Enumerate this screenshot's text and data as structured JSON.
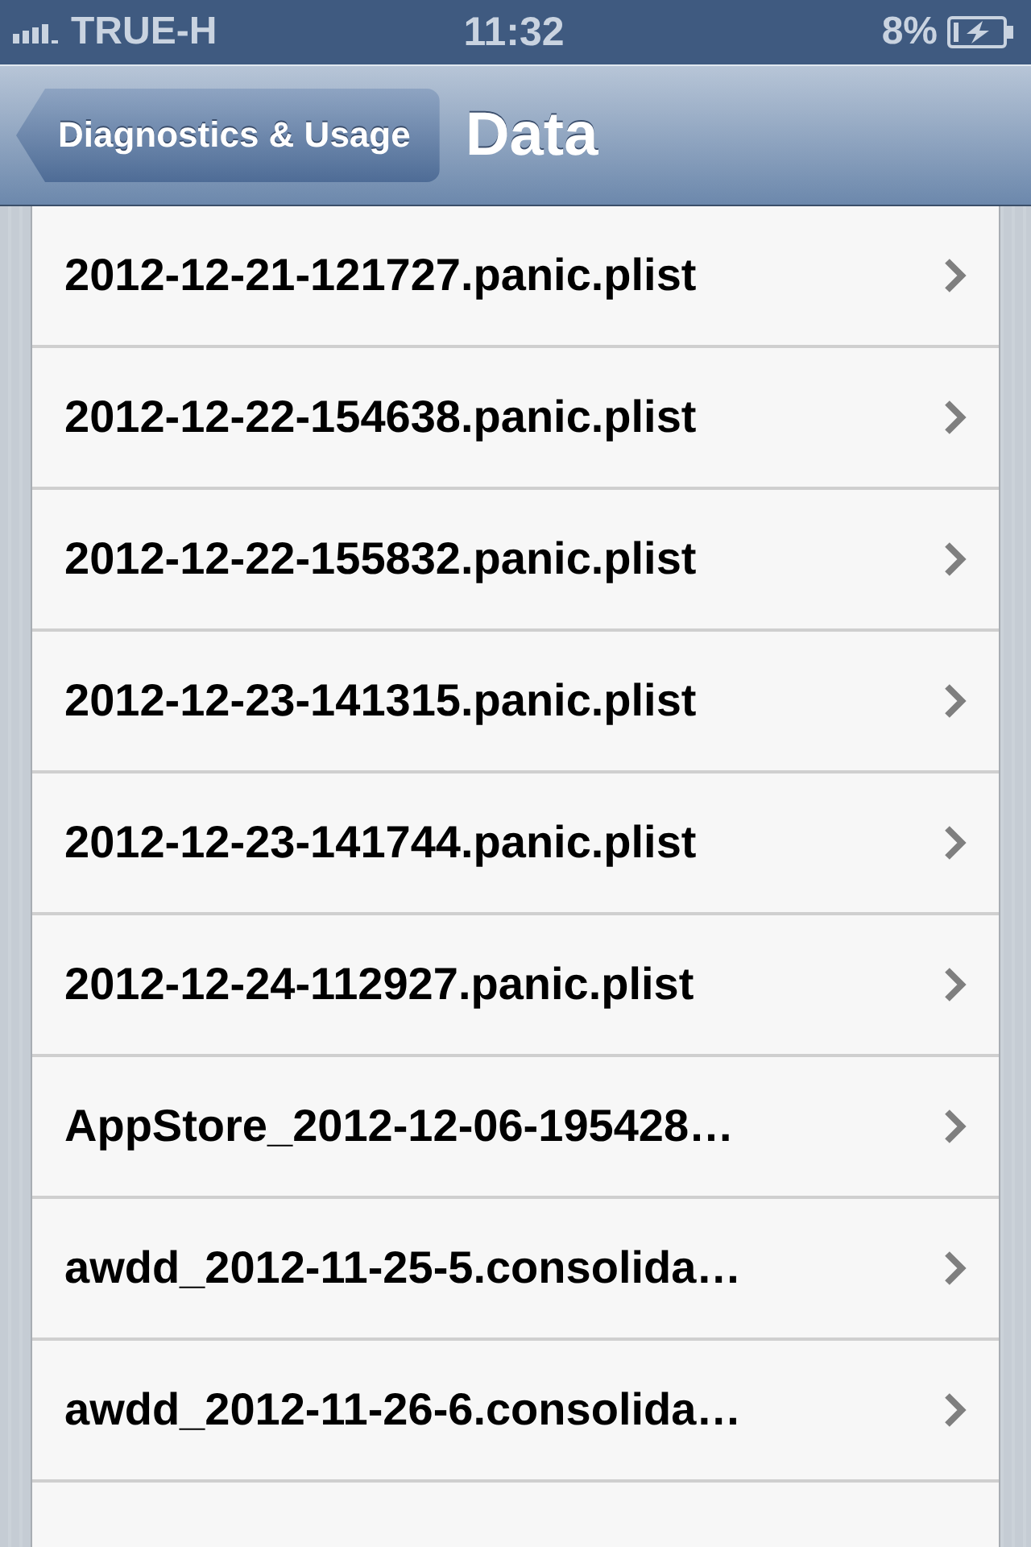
{
  "status_bar": {
    "carrier": "TRUE-H",
    "time": "11:32",
    "battery": "8%"
  },
  "nav_bar": {
    "back_button": "Diagnostics & Usage",
    "title": "Data"
  },
  "rows": [
    {
      "label": "2012-12-21-121727.panic.plist"
    },
    {
      "label": "2012-12-22-154638.panic.plist"
    },
    {
      "label": "2012-12-22-155832.panic.plist"
    },
    {
      "label": "2012-12-23-141315.panic.plist"
    },
    {
      "label": "2012-12-23-141744.panic.plist"
    },
    {
      "label": "2012-12-24-112927.panic.plist"
    },
    {
      "label": "AppStore_2012-12-06-195428…"
    },
    {
      "label": "awdd_2012-11-25-5.consolida…"
    },
    {
      "label": "awdd_2012-11-26-6.consolida…"
    }
  ]
}
